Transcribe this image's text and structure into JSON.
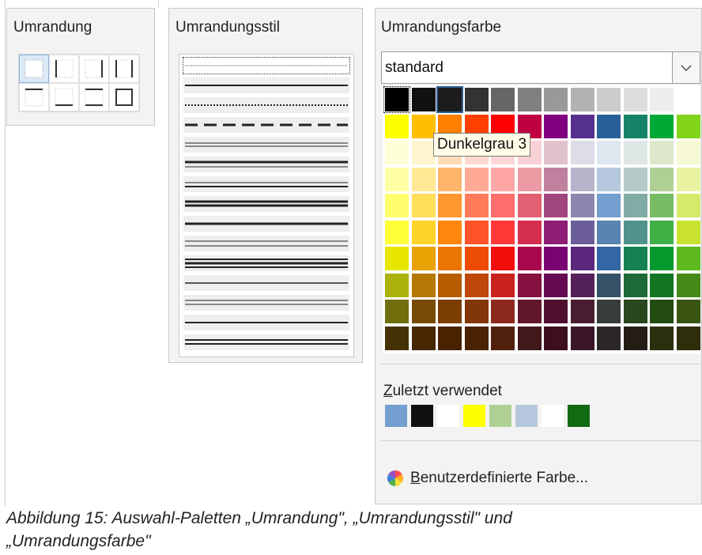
{
  "border_panel": {
    "title": "Umrandung",
    "presets": [
      "none",
      "left",
      "right",
      "left-right",
      "top",
      "bottom",
      "top-bottom",
      "box"
    ]
  },
  "style_panel": {
    "title": "Umrandungsstil",
    "styles": [
      "dotted-fine",
      "solid-thin",
      "dotted",
      "dashed",
      "double-thin",
      "double-thick-thin",
      "double-thin-thin",
      "thick-double",
      "solid-medium",
      "double-spaced",
      "triple",
      "solid-grey",
      "double-medium",
      "solid-thin-2",
      "double-equal"
    ]
  },
  "color_panel": {
    "title": "Umrandungsfarbe",
    "palette_value": "standard",
    "tooltip": "Dunkelgrau 3",
    "recent_label_prefix": "Z",
    "recent_label_rest": "uletzt verwendet",
    "recent_colors": [
      "#729fcf",
      "#111111",
      "#ffffff",
      "#ffff00",
      "#afd095",
      "#b4c7dc",
      "#ffffff",
      "#126b12"
    ],
    "custom_prefix": "B",
    "custom_rest": "enutzerdefinierte Farbe...",
    "palette_rows": [
      [
        "#000000",
        "#111111",
        "#1c1c1c",
        "#333333",
        "#666666",
        "#808080",
        "#999999",
        "#b2b2b2",
        "#cccccc",
        "#dddddd",
        "#eeeeee",
        "#ffffff"
      ],
      [
        "#ffff00",
        "#ffbf00",
        "#ff8000",
        "#ff4000",
        "#ff0000",
        "#bf0041",
        "#800080",
        "#55308d",
        "#2a6099",
        "#158466",
        "#00a933",
        "#81d41a"
      ],
      [
        "#ffffd7",
        "#fff5ce",
        "#ffdbb6",
        "#ffd8ce",
        "#ffd7d7",
        "#f7d1d5",
        "#e0c2cd",
        "#dedce6",
        "#dee6ef",
        "#dee7e5",
        "#dde8cb",
        "#f6f9d4"
      ],
      [
        "#ffffa6",
        "#ffe994",
        "#ffb66c",
        "#ffaa95",
        "#ffa6a6",
        "#ec9ba4",
        "#bf819e",
        "#b7b3ca",
        "#b4c7dc",
        "#b3cac7",
        "#afd095",
        "#e8f2a1"
      ],
      [
        "#ffff6d",
        "#ffde59",
        "#ff972f",
        "#ff7b59",
        "#ff6d6d",
        "#e16173",
        "#a1467e",
        "#8e86ae",
        "#729fcf",
        "#81aca6",
        "#77bc65",
        "#d4ea6b"
      ],
      [
        "#ffff38",
        "#ffd428",
        "#ff860d",
        "#ff5429",
        "#ff3838",
        "#d62e4e",
        "#8d1d75",
        "#6b5e9b",
        "#5983b0",
        "#50938a",
        "#3faf46",
        "#c9e231"
      ],
      [
        "#e6e600",
        "#e8a202",
        "#ea7500",
        "#ed4c05",
        "#f10d0c",
        "#a7074b",
        "#780373",
        "#5b277d",
        "#3465a4",
        "#168253",
        "#069a2e",
        "#5eb91e"
      ],
      [
        "#acb20c",
        "#b47804",
        "#b85c00",
        "#be480a",
        "#c9211e",
        "#861141",
        "#650953",
        "#55215b",
        "#355269",
        "#1e6a39",
        "#127622",
        "#468a1a"
      ],
      [
        "#706e0c",
        "#784b04",
        "#7b3d00",
        "#813709",
        "#8d281e",
        "#611729",
        "#4e102d",
        "#481d32",
        "#383d3c",
        "#28471f",
        "#224b12",
        "#395511"
      ],
      [
        "#443205",
        "#472702",
        "#492300",
        "#4b2204",
        "#50200c",
        "#41191a",
        "#3c0e1f",
        "#3a1628",
        "#2b2726",
        "#241d16",
        "#2b2f0d",
        "#2e2e0a"
      ]
    ]
  },
  "caption": {
    "line1": "Abbildung 15: Auswahl-Paletten „Umrandung\", „Umrandungsstil\" und",
    "line2": "„Umrandungsfarbe\""
  }
}
